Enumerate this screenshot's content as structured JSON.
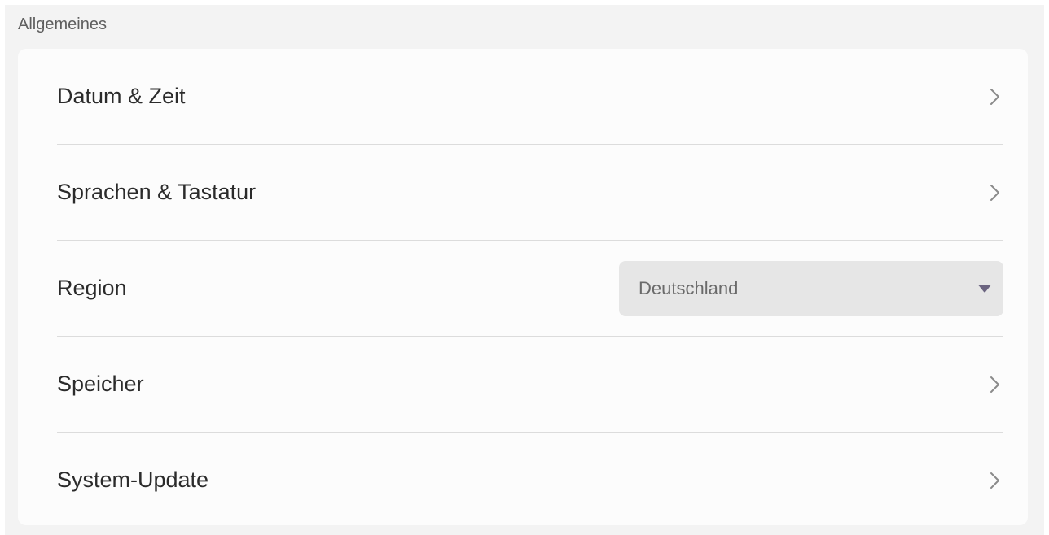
{
  "section": {
    "title": "Allgemeines"
  },
  "rows": [
    {
      "label": "Datum & Zeit",
      "icon": "chevron-right-icon"
    },
    {
      "label": "Sprachen & Tastatur",
      "icon": "chevron-right-icon"
    },
    {
      "label": "Region",
      "dropdown_value": "Deutschland",
      "icon": "caret-down-icon"
    },
    {
      "label": "Speicher",
      "icon": "chevron-right-icon"
    },
    {
      "label": "System-Update",
      "icon": "chevron-right-icon"
    }
  ],
  "colors": {
    "caret": "#6b6480",
    "chevron": "#8a8a8a"
  }
}
